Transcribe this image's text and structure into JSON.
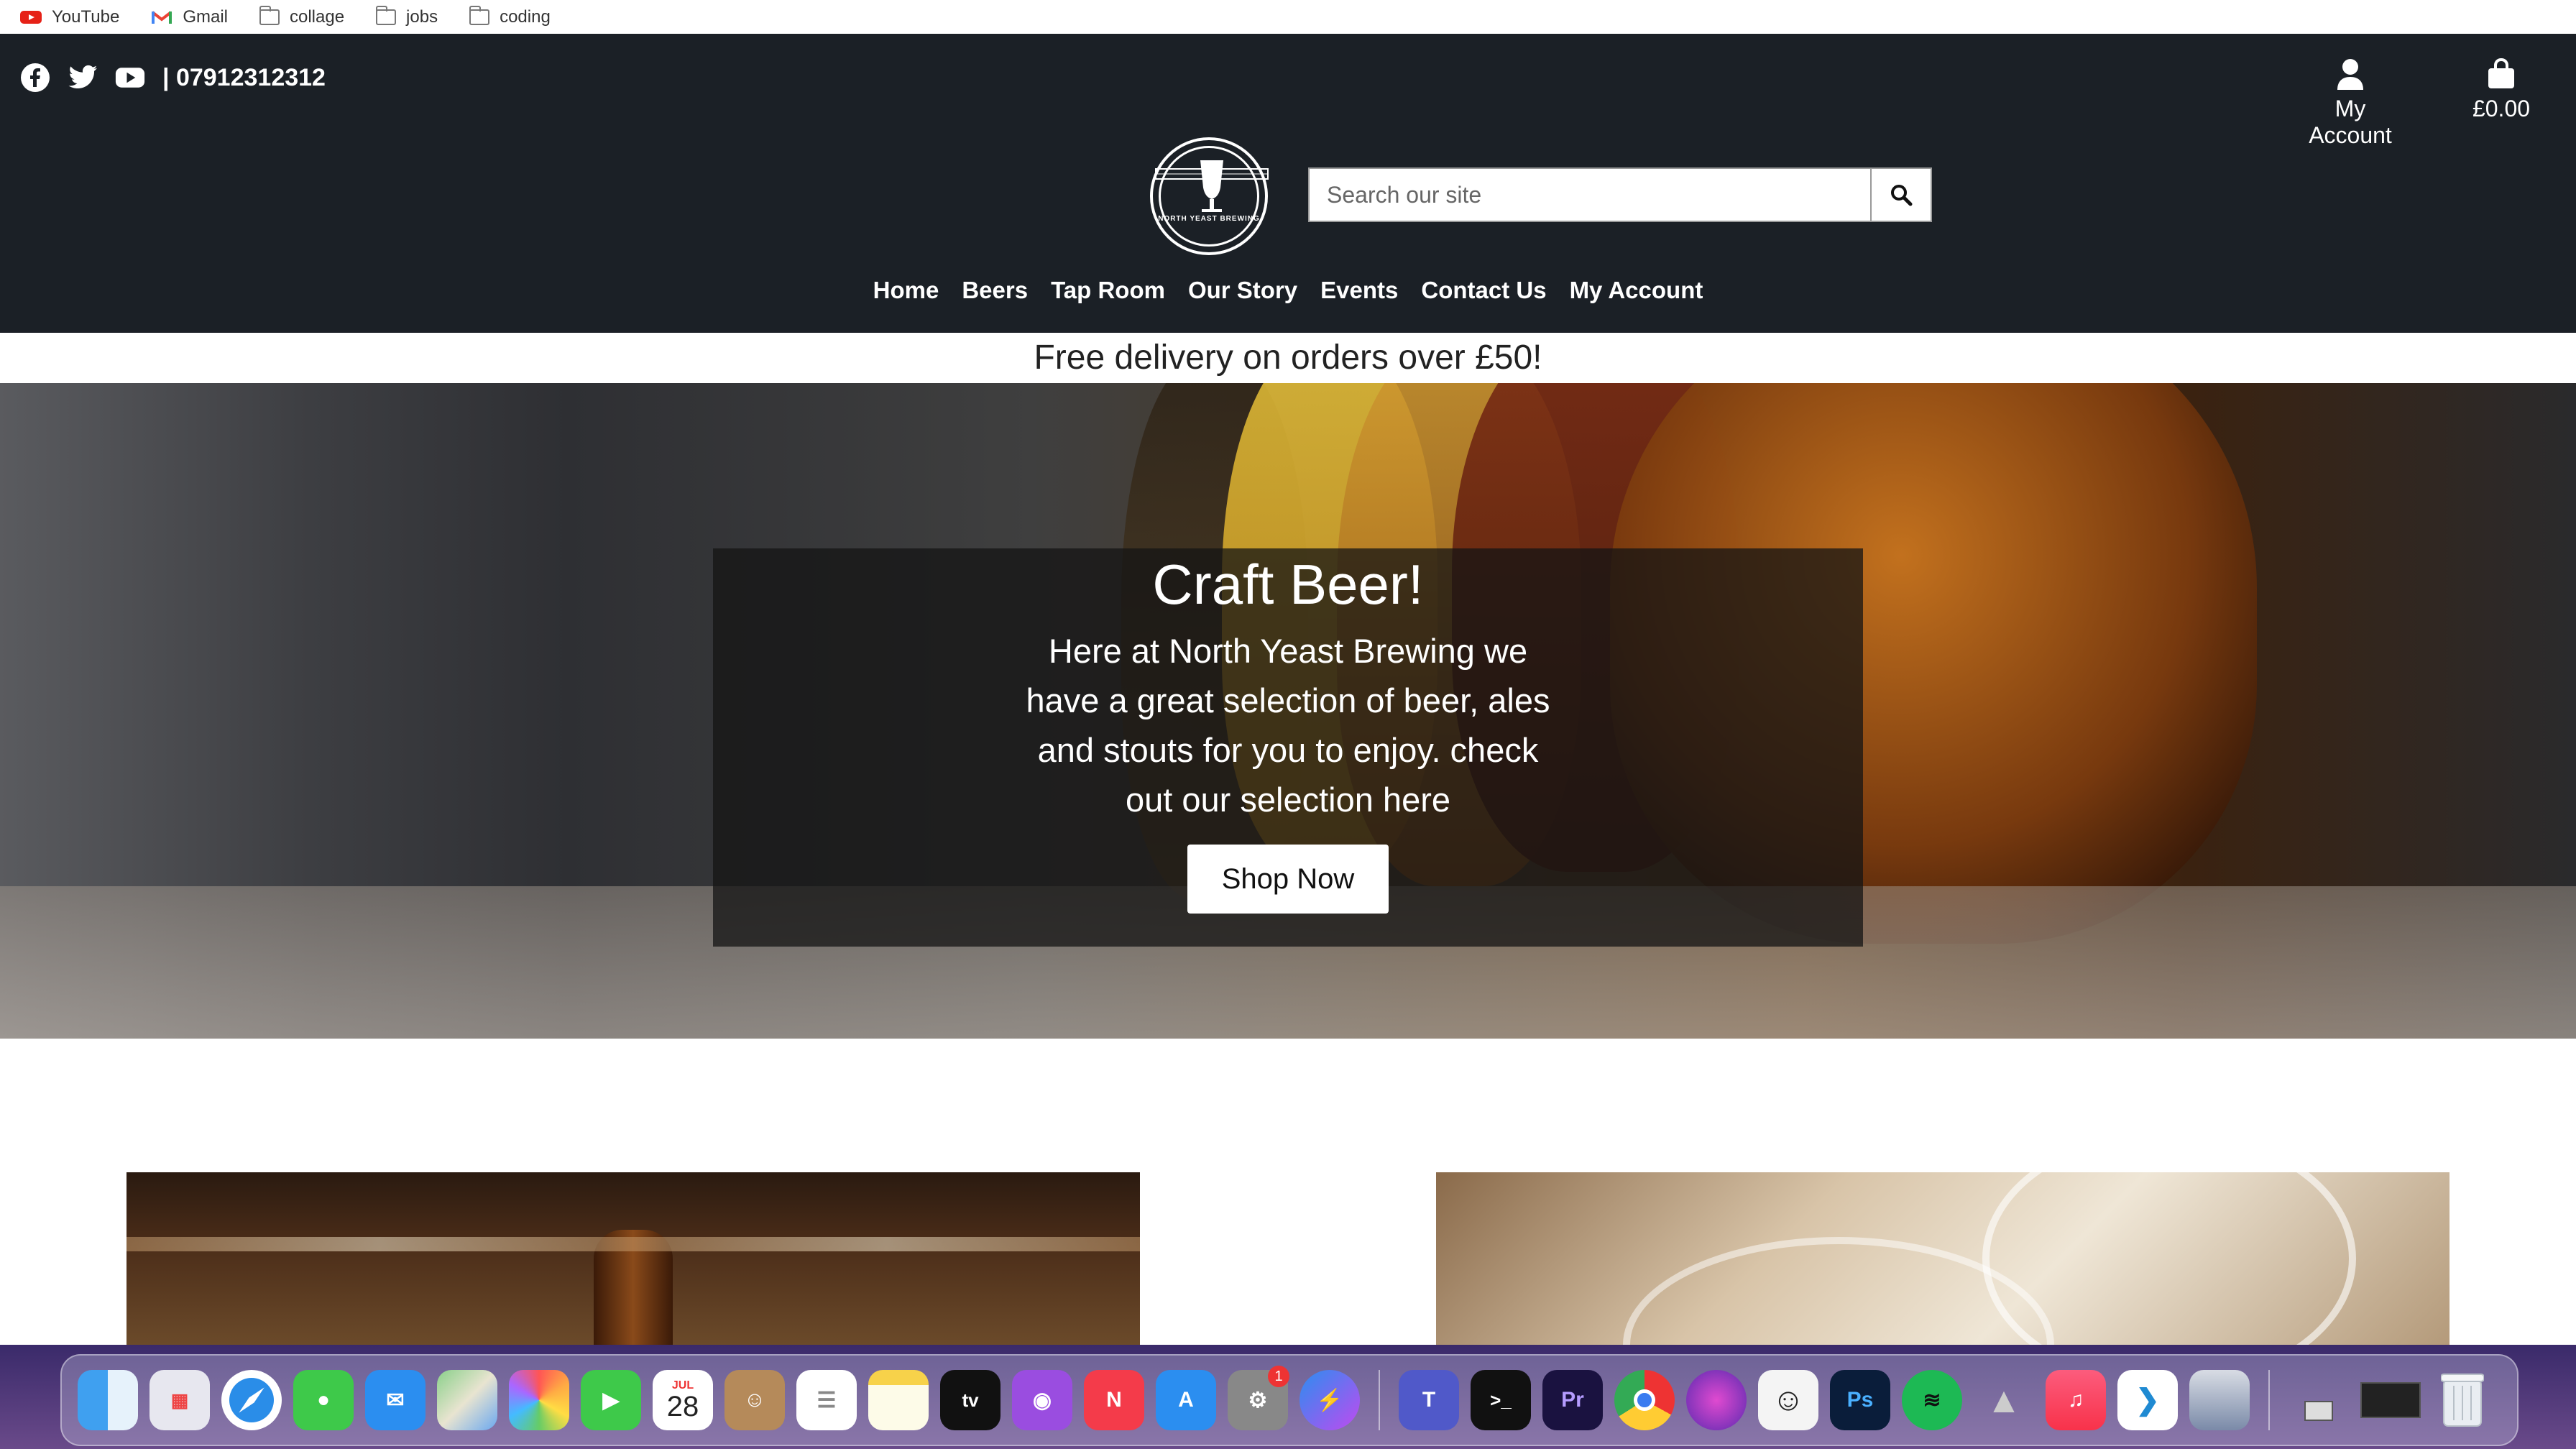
{
  "bookmarks": [
    {
      "label": "YouTube",
      "icon": "youtube-icon"
    },
    {
      "label": "Gmail",
      "icon": "gmail-icon"
    },
    {
      "label": "collage",
      "icon": "folder-icon"
    },
    {
      "label": "jobs",
      "icon": "folder-icon"
    },
    {
      "label": "coding",
      "icon": "folder-icon"
    }
  ],
  "header": {
    "phone": "| 07912312312",
    "account_label": "My Account",
    "cart_total": "£0.00",
    "search_placeholder": "Search our site",
    "logo_text": "NORTH YEAST BREWING"
  },
  "nav": {
    "items": [
      "Home",
      "Beers",
      "Tap Room",
      "Our Story",
      "Events",
      "Contact Us",
      "My Account"
    ]
  },
  "promo": {
    "text": "Free delivery on orders over £50!"
  },
  "hero": {
    "title": "Craft Beer!",
    "text": "Here at North Yeast Brewing we have a great selection of beer, ales and stouts for you to enjoy. check out our selection here",
    "button": "Shop Now"
  },
  "dock": {
    "calendar_month": "JUL",
    "calendar_day": "28",
    "badge_count": "1"
  },
  "colors": {
    "header_bg": "#1b2026",
    "promo_bg": "#ffffff",
    "hero_overlay": "rgba(20,20,20,0.75)"
  }
}
